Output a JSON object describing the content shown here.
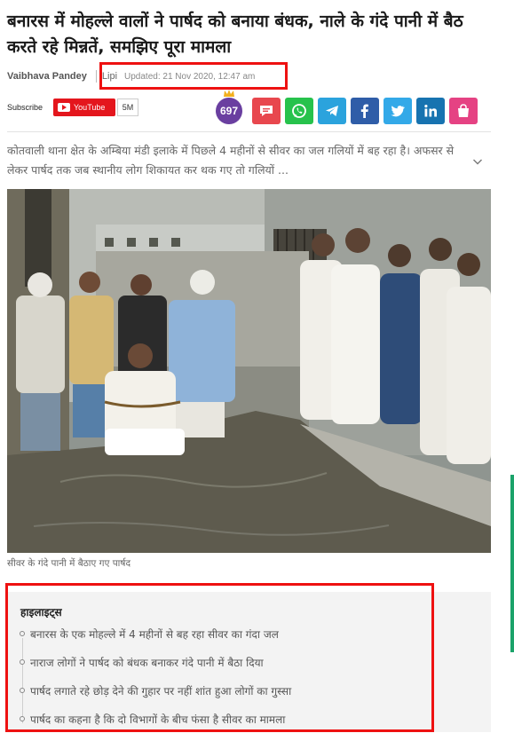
{
  "article": {
    "headline": "बनारस में मोहल्ले वालों ने पार्षद को बनाया बंधक, नाले के गंदे पानी में बैठ करते रहे मिन्नतें, समझिए पूरा मामला",
    "author": "Vaibhava Pandey",
    "source": "Lipi",
    "updated": "Updated: 21 Nov 2020, 12:47 am",
    "summary": "कोतवाली थाना क्षेत के अम्बिया मंडी इलाके में पिछले 4 महीनों से सीवर का जल गलियों में बह रहा है। अफसर से लेकर पार्षद तक जब स्थानीय लोग शिकायत कर थक गए तो गलियों ...",
    "photo_caption": "सीवर के गंदे पानी में बैठाए गए पार्षद"
  },
  "social": {
    "subscribe_label": "Subscribe",
    "youtube_label": "YouTube",
    "youtube_count": "5M",
    "reaction_count": "697",
    "share_buttons": [
      {
        "name": "comment-icon",
        "color": "#e8474e"
      },
      {
        "name": "whatsapp-icon",
        "color": "#27c24c"
      },
      {
        "name": "telegram-icon",
        "color": "#2ba3dd"
      },
      {
        "name": "facebook-icon",
        "color": "#2f5da8"
      },
      {
        "name": "twitter-icon",
        "color": "#33a9e8"
      },
      {
        "name": "linkedin-icon",
        "color": "#1773b0"
      },
      {
        "name": "bag-icon",
        "color": "#e54283"
      }
    ]
  },
  "highlights": {
    "title": "हाइलाइट्स",
    "items": [
      "बनारस के एक मोहल्ले में 4 महीनों से बह रहा सीवर का गंदा जल",
      "नाराज लोगों ने पार्षद को बंधक बनाकर गंदे पानी में बैठा दिया",
      "पार्षद लगाते रहे छोड़ देने की गुहार पर नहीं शांत हुआ लोगों का गुस्सा",
      "पार्षद का कहना है कि दो विभागों के बीच फंसा है सीवर का मामला"
    ]
  },
  "colors": {
    "annotation_box": "#ee1111",
    "youtube": "#e4161d",
    "badge": "#6a3fa0"
  }
}
